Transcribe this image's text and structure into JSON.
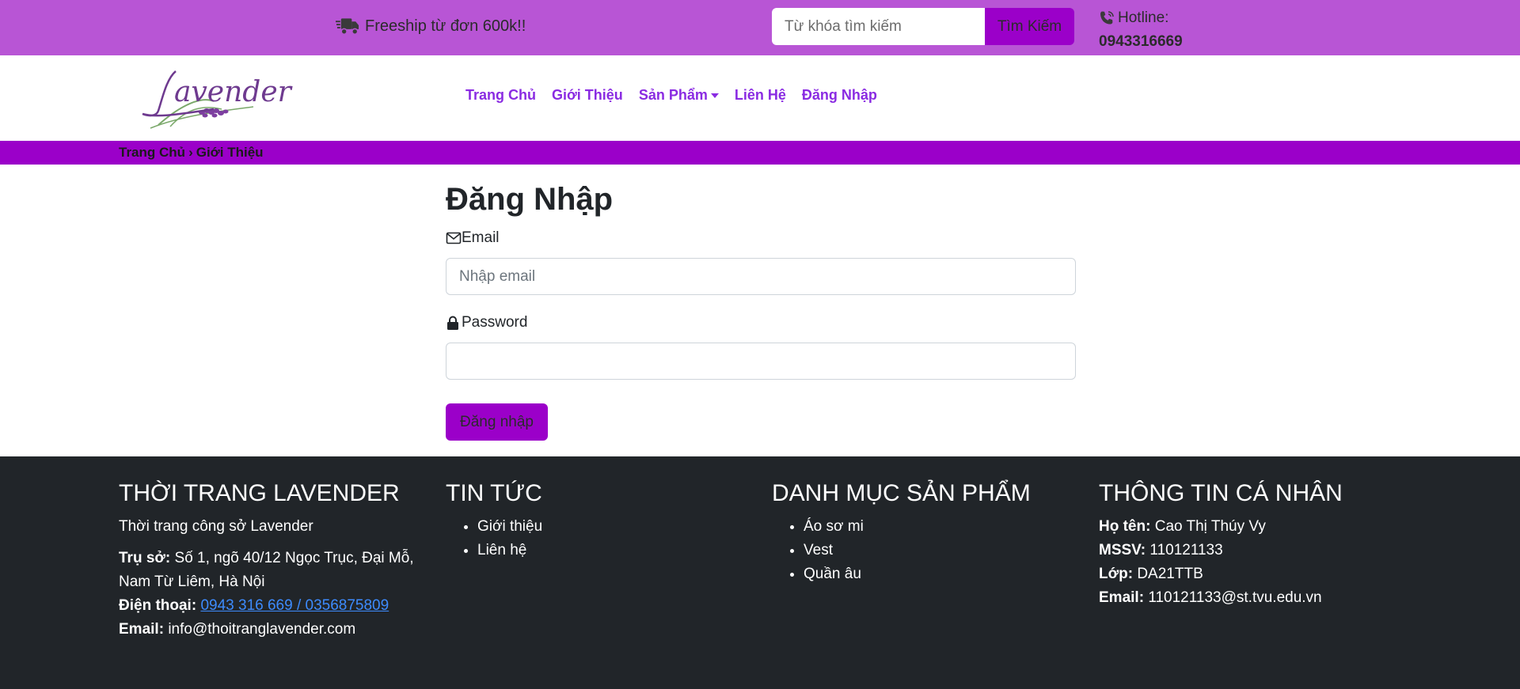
{
  "topbar": {
    "freeship_text": "Freeship từ đơn 600k!!",
    "search_placeholder": "Từ khóa tìm kiếm",
    "search_button": "Tìm Kiếm",
    "hotline_label": "Hotline:",
    "hotline_number": "0943316669"
  },
  "nav": {
    "logo_text": "Lavender",
    "items": [
      "Trang Chủ",
      "Giới Thiệu",
      "Sản Phẩm",
      "Liên Hệ",
      "Đăng Nhập"
    ]
  },
  "breadcrumb": {
    "home": "Trang Chủ",
    "separator": "›",
    "current": "Giới Thiệu"
  },
  "login": {
    "title": "Đăng Nhập",
    "email_label": "Email",
    "email_placeholder": "Nhập email",
    "password_label": "Password",
    "password_value": "",
    "submit_label": "Đăng nhập"
  },
  "footer": {
    "col1": {
      "title": "THỜI TRANG LAVENDER",
      "tagline": "Thời trang công sở Lavender",
      "address_label": "Trụ sở:",
      "address_value": "Số 1, ngõ 40/12 Ngọc Trục, Đại Mỗ, Nam Từ Liêm, Hà Nội",
      "phone_label": "Điện thoại:",
      "phone_value": "0943 316 669 / 0356875809",
      "email_label": "Email:",
      "email_value": "info@thoitranglavender.com"
    },
    "col2": {
      "title": "TIN TỨC",
      "items": [
        "Giới thiệu",
        "Liên hệ"
      ]
    },
    "col3": {
      "title": "DANH MỤC SẢN PHẨM",
      "items": [
        "Áo sơ mi",
        "Vest",
        "Quần âu"
      ]
    },
    "col4": {
      "title": "THÔNG TIN CÁ NHÂN",
      "name_label": "Họ tên:",
      "name_value": "Cao Thị Thúy Vy",
      "mssv_label": "MSSV:",
      "mssv_value": "110121133",
      "class_label": "Lớp:",
      "class_value": "DA21TTB",
      "email_label": "Email:",
      "email_value": "110121133@st.tvu.edu.vn"
    }
  },
  "colors": {
    "topbar_bg": "#b855d5",
    "accent": "#9b00c9",
    "nav_link": "#8a2be2",
    "footer_bg": "#212529"
  }
}
